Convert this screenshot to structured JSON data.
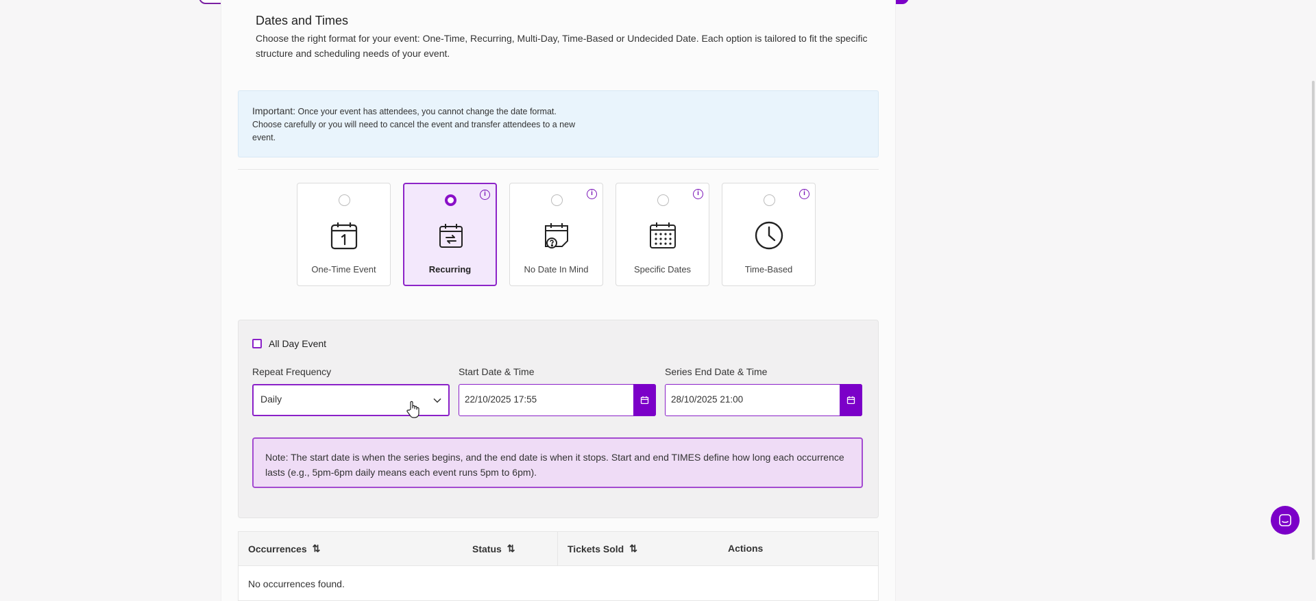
{
  "section": {
    "title": "Dates and Times",
    "description": "Choose the right format for your event: One-Time, Recurring, Multi-Day, Time-Based or Undecided Date. Each option is tailored to fit the specific structure and scheduling needs of your event."
  },
  "important": {
    "label": "Important:",
    "text": "Once your event has attendees, you cannot change the date format. Choose carefully or you will need to cancel the event and transfer attendees to a new event."
  },
  "date_formats": [
    {
      "label": "One-Time Event",
      "icon": "calendar-one-icon",
      "selected": false
    },
    {
      "label": "Recurring",
      "icon": "calendar-repeat-icon",
      "selected": true
    },
    {
      "label": "No Date In Mind",
      "icon": "calendar-question-icon",
      "selected": false
    },
    {
      "label": "Specific Dates",
      "icon": "calendar-dots-icon",
      "selected": false
    },
    {
      "label": "Time-Based",
      "icon": "clock-icon",
      "selected": false
    }
  ],
  "form": {
    "all_day_label": "All Day Event",
    "repeat_frequency_label": "Repeat Frequency",
    "repeat_frequency_value": "Daily",
    "start_label": "Start Date & Time",
    "start_value": "22/10/2025 17:55",
    "end_label": "Series End Date & Time",
    "end_value": "28/10/2025 21:00",
    "note": "Note: The start date is when the series begins, and the end date is when it stops. Start and end TIMES define how long each occurrence lasts (e.g., 5pm-6pm daily means each event runs 5pm to 6pm)."
  },
  "table": {
    "headers": [
      "Occurrences",
      "Status",
      "Tickets Sold",
      "Actions"
    ],
    "empty_text": "No occurrences found."
  },
  "colors": {
    "accent": "#7b00c8",
    "info_bg": "#e9f4fc",
    "note_bg": "#efdcf6"
  }
}
